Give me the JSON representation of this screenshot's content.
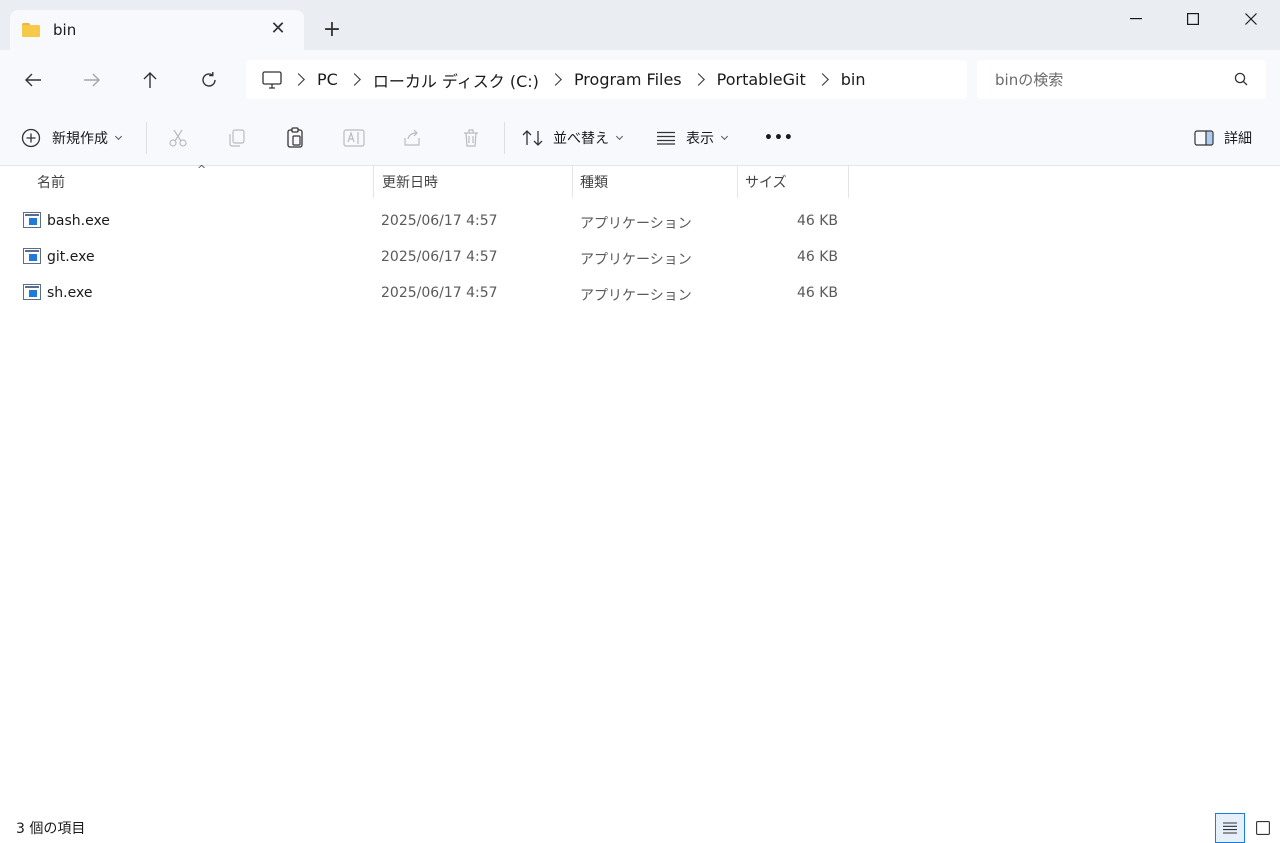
{
  "tab": {
    "title": "bin",
    "folder_color": "#f7c948"
  },
  "window": {
    "minimize": "minimize",
    "maximize": "maximize",
    "close": "close"
  },
  "breadcrumb": [
    "PC",
    "ローカル ディスク (C:)",
    "Program Files",
    "PortableGit",
    "bin"
  ],
  "search": {
    "placeholder": "binの検索"
  },
  "toolbar": {
    "new_label": "新規作成",
    "sort_label": "並べ替え",
    "view_label": "表示",
    "more_label": "•••",
    "details_label": "詳細"
  },
  "columns": {
    "name": "名前",
    "date": "更新日時",
    "type": "種類",
    "size": "サイズ"
  },
  "files": [
    {
      "name": "bash.exe",
      "date": "2025/06/17 4:57",
      "type": "アプリケーション",
      "size": "46 KB"
    },
    {
      "name": "git.exe",
      "date": "2025/06/17 4:57",
      "type": "アプリケーション",
      "size": "46 KB"
    },
    {
      "name": "sh.exe",
      "date": "2025/06/17 4:57",
      "type": "アプリケーション",
      "size": "46 KB"
    }
  ],
  "status": {
    "count_text": "3 個の項目"
  },
  "colors": {
    "accent": "#1f7ad8",
    "chrome": "#eaeef3",
    "panel": "#f7f9fc"
  }
}
